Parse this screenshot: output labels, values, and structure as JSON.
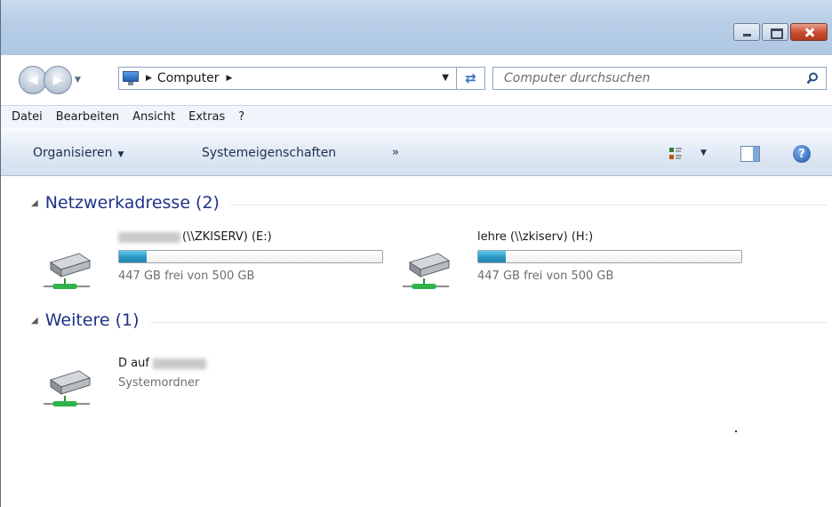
{
  "window": {
    "caption_buttons": [
      "minimize",
      "maximize",
      "close"
    ]
  },
  "address": {
    "crumbs": [
      "Computer"
    ],
    "search_placeholder": "Computer durchsuchen"
  },
  "menubar": {
    "items": [
      "Datei",
      "Bearbeiten",
      "Ansicht",
      "Extras",
      "?"
    ]
  },
  "toolbar": {
    "organize_label": "Organisieren",
    "system_properties_label": "Systemeigenschaften",
    "more_label": "»"
  },
  "groups": [
    {
      "title": "Netzwerkadresse (2)",
      "drives": [
        {
          "name": "(\\\\ZKISERV) (E:)",
          "free_text": "447 GB frei von 500 GB",
          "used_fraction": 0.106
        },
        {
          "name": "lehre (\\\\zkiserv) (H:)",
          "free_text": "447 GB frei von 500 GB",
          "used_fraction": 0.106
        }
      ]
    },
    {
      "title": "Weitere (1)",
      "drives": [
        {
          "name": "D auf",
          "subtitle": "Systemordner"
        }
      ]
    }
  ],
  "colors": {
    "capacity_fill": "#2a97c4",
    "group_title": "#1e3287"
  }
}
